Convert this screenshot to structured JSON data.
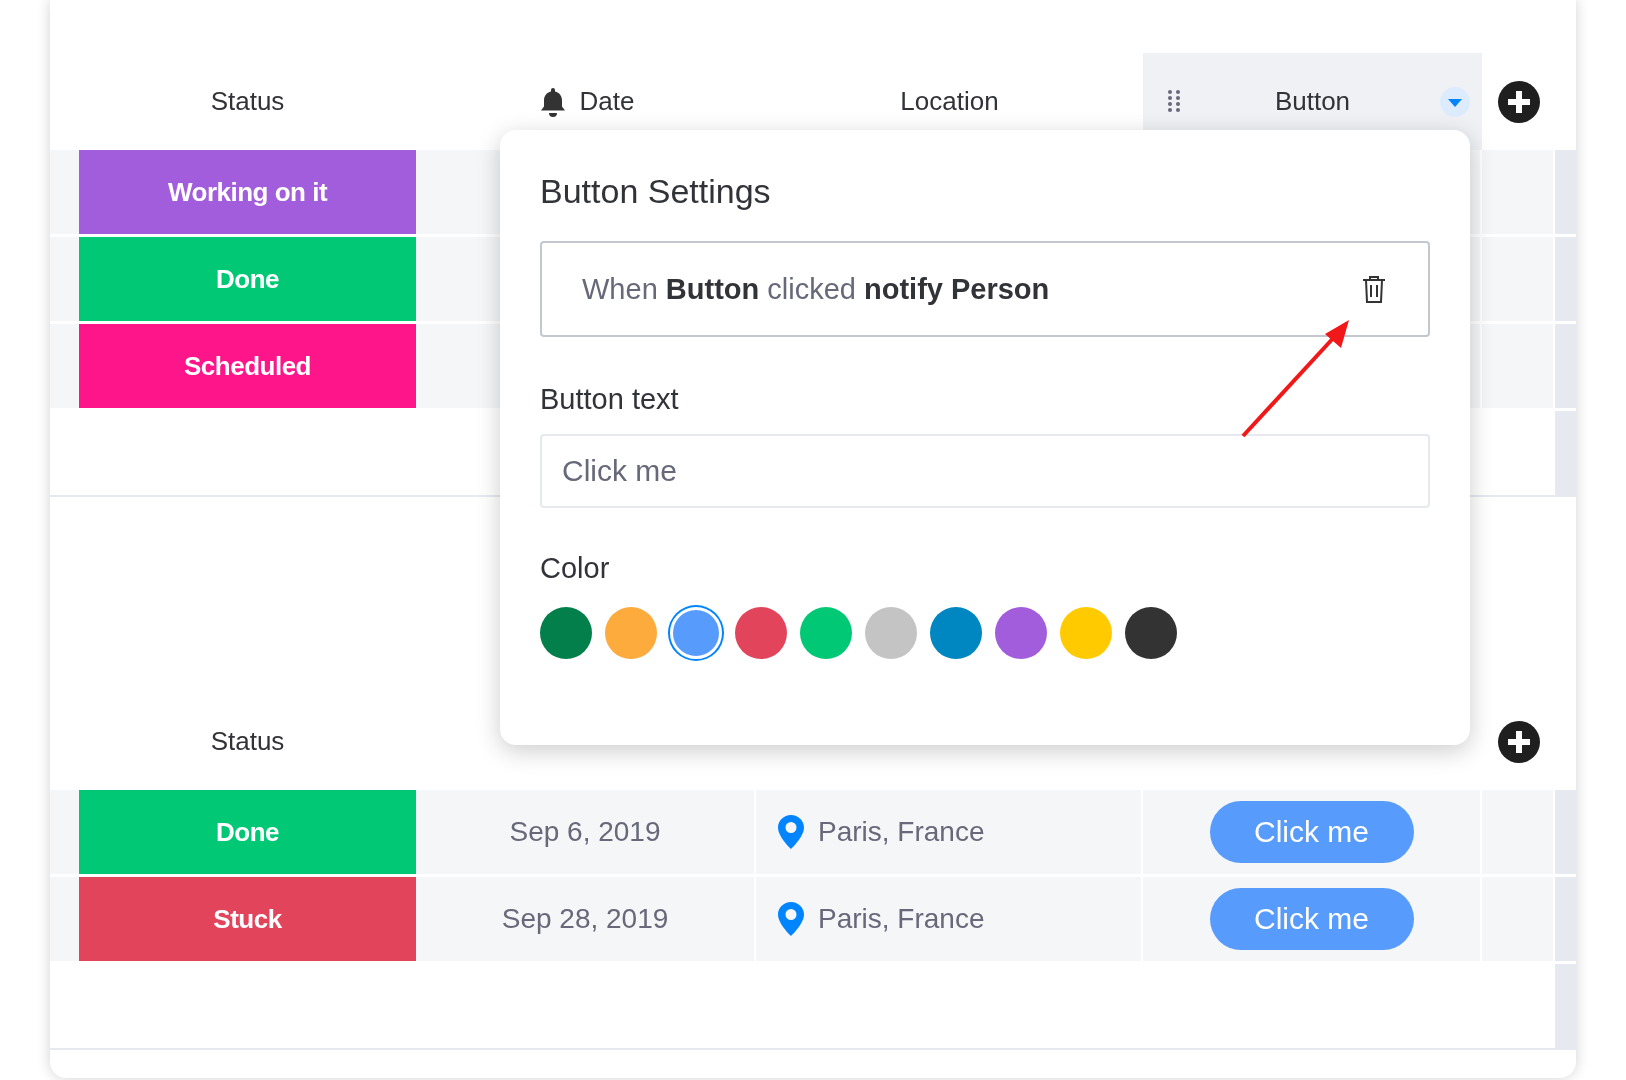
{
  "top_group": {
    "columns": [
      {
        "label": "Status",
        "kind": "plain"
      },
      {
        "label": "Date",
        "kind": "bell"
      },
      {
        "label": "Location",
        "kind": "plain"
      },
      {
        "label": "Button",
        "kind": "menu"
      }
    ],
    "rows": [
      {
        "status": "Working on it",
        "color": "#a25ddc"
      },
      {
        "status": "Done",
        "color": "#00c875"
      },
      {
        "status": "Scheduled",
        "color": "#ff158a"
      }
    ]
  },
  "bottom_group": {
    "columns": [
      {
        "label": "Status"
      }
    ],
    "rows": [
      {
        "status": "Done",
        "color": "#00c875",
        "date": "Sep 6, 2019",
        "location": "Paris, France",
        "button": "Click me"
      },
      {
        "status": "Stuck",
        "color": "#e2445c",
        "date": "Sep 28, 2019",
        "location": "Paris, France",
        "button": "Click me"
      }
    ]
  },
  "popover": {
    "title": "Button Settings",
    "rule": "When **Button** clicked **notify Person**",
    "field_label": "Button text",
    "field_value": "Click me",
    "color_label": "Color",
    "swatches": [
      {
        "color": "#037f4c",
        "selected": false
      },
      {
        "color": "#fdab3d",
        "selected": false
      },
      {
        "color": "#579bfc",
        "selected": true
      },
      {
        "color": "#e2445c",
        "selected": false
      },
      {
        "color": "#00c875",
        "selected": false
      },
      {
        "color": "#c4c4c4",
        "selected": false
      },
      {
        "color": "#0086c0",
        "selected": false
      },
      {
        "color": "#a25ddc",
        "selected": false
      },
      {
        "color": "#ffcb00",
        "selected": false
      },
      {
        "color": "#333333",
        "selected": false
      }
    ]
  }
}
